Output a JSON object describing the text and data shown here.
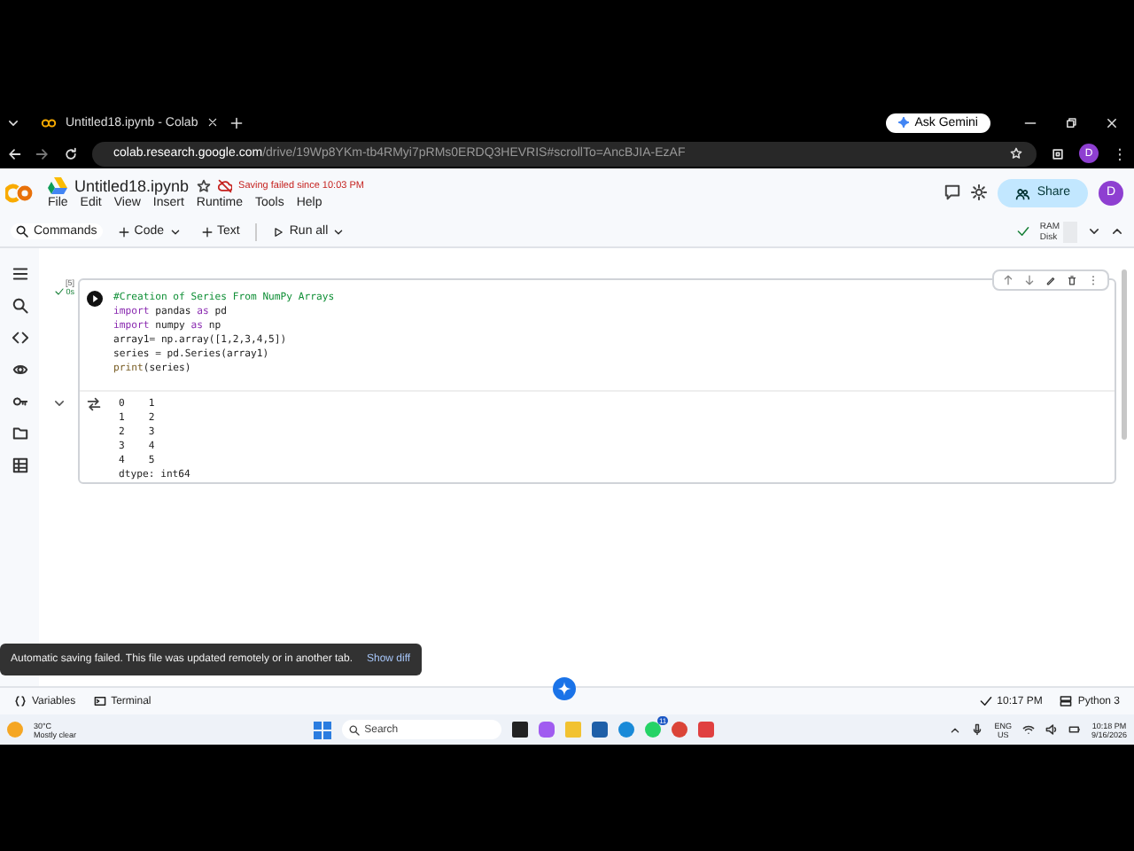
{
  "browser": {
    "tab_title": "Untitled18.ipynb - Colab",
    "ask_button": "Ask Gemini",
    "url_host": "colab.research.google.com",
    "url_path": "/drive/19Wp8YKm-tb4RMyi7pRMs0ERDQ3HEVRIS#scrollTo=AncBJIA-EzAF",
    "profile": "D"
  },
  "header": {
    "file_name": "Untitled18.ipynb",
    "save_status": "Saving failed since 10:03 PM",
    "menu": [
      "File",
      "Edit",
      "View",
      "Insert",
      "Runtime",
      "Tools",
      "Help"
    ],
    "share": "Share",
    "avatar": "D"
  },
  "toolbar": {
    "commands": "Commands",
    "code": "Code",
    "text": "Text",
    "run_all": "Run all",
    "ram": "RAM",
    "disk": "Disk"
  },
  "cell": {
    "exec_count": "[5]",
    "exec_time": "0s",
    "lines": [
      [
        {
          "t": "#Creation of Series From NumPy Arrays",
          "kind": "comment"
        }
      ],
      [
        {
          "t": "import",
          "kind": "keyword"
        },
        {
          "t": " pandas ",
          "kind": "plain"
        },
        {
          "t": "as",
          "kind": "keyword"
        },
        {
          "t": " pd",
          "kind": "plain"
        }
      ],
      [
        {
          "t": "import",
          "kind": "keyword"
        },
        {
          "t": " numpy ",
          "kind": "plain"
        },
        {
          "t": "as",
          "kind": "keyword"
        },
        {
          "t": " np",
          "kind": "plain"
        }
      ],
      [
        {
          "t": "array1= np.array([1,2,3,4,5])",
          "kind": "plain"
        }
      ],
      [
        {
          "t": "series = pd.Series(array1)",
          "kind": "plain"
        }
      ],
      [
        {
          "t": "print",
          "kind": "function"
        },
        {
          "t": "(series)",
          "kind": "plain"
        }
      ]
    ],
    "output": [
      "0    1",
      "1    2",
      "2    3",
      "3    4",
      "4    5",
      "dtype: int64"
    ]
  },
  "snackbar": {
    "message": "Automatic saving failed. This file was updated remotely or in another tab.",
    "action": "Show diff"
  },
  "status_bar": {
    "variables": "Variables",
    "terminal": "Terminal",
    "time": "10:17 PM",
    "kernel": "Python 3"
  },
  "taskbar": {
    "temperature": "30°C",
    "weather": "Mostly clear",
    "search": "Search",
    "whatsapp_badge": "11",
    "lang": "ENG",
    "region": "US",
    "time": "10:18 PM",
    "date": "9/16/2026",
    "apps": [
      {
        "kind": "terminal",
        "color": "#222222"
      },
      {
        "kind": "copilot",
        "color": "#a05cf0"
      },
      {
        "kind": "folder",
        "color": "#f2c230"
      },
      {
        "kind": "store",
        "color": "#1f5fa8"
      },
      {
        "kind": "edge",
        "color": "#1a8ad8"
      },
      {
        "kind": "whatsapp",
        "color": "#25d366"
      },
      {
        "kind": "chrome",
        "color": "#db4437"
      },
      {
        "kind": "snip",
        "color": "#e04040"
      }
    ]
  }
}
